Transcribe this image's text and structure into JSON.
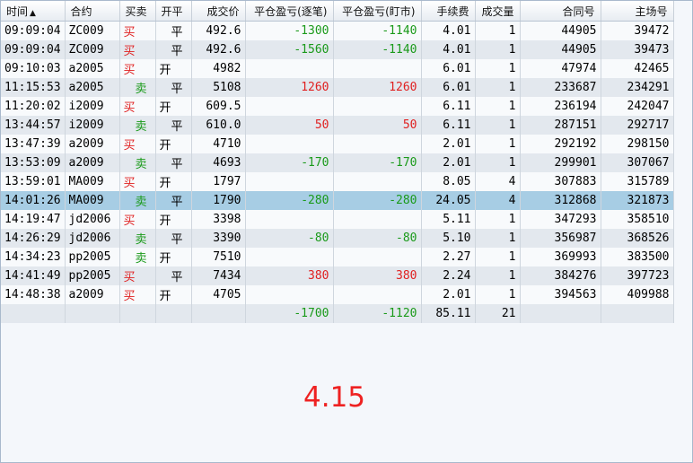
{
  "columns": [
    "时间",
    "合约",
    "买卖",
    "开平",
    "成交价",
    "平仓盈亏(逐笔)",
    "平仓盈亏(盯市)",
    "手续费",
    "成交量",
    "合同号",
    "主场号"
  ],
  "sort_indicator": "▲",
  "rows": [
    {
      "time": "09:09:04",
      "contract": "ZC009",
      "side": "买",
      "oc": "平",
      "price": "492.6",
      "pnl_trade": "-1300",
      "pnl_mtm": "-1140",
      "fee": "4.01",
      "qty": "1",
      "contract_no": "44905",
      "main_no": "39472"
    },
    {
      "time": "09:09:04",
      "contract": "ZC009",
      "side": "买",
      "oc": "平",
      "price": "492.6",
      "pnl_trade": "-1560",
      "pnl_mtm": "-1140",
      "fee": "4.01",
      "qty": "1",
      "contract_no": "44905",
      "main_no": "39473"
    },
    {
      "time": "09:10:03",
      "contract": "a2005",
      "side": "买",
      "oc": "开",
      "price": "4982",
      "pnl_trade": "",
      "pnl_mtm": "",
      "fee": "6.01",
      "qty": "1",
      "contract_no": "47974",
      "main_no": "42465"
    },
    {
      "time": "11:15:53",
      "contract": "a2005",
      "side": "卖",
      "oc": "平",
      "price": "5108",
      "pnl_trade": "1260",
      "pnl_mtm": "1260",
      "fee": "6.01",
      "qty": "1",
      "contract_no": "233687",
      "main_no": "234291"
    },
    {
      "time": "11:20:02",
      "contract": "i2009",
      "side": "买",
      "oc": "开",
      "price": "609.5",
      "pnl_trade": "",
      "pnl_mtm": "",
      "fee": "6.11",
      "qty": "1",
      "contract_no": "236194",
      "main_no": "242047"
    },
    {
      "time": "13:44:57",
      "contract": "i2009",
      "side": "卖",
      "oc": "平",
      "price": "610.0",
      "pnl_trade": "50",
      "pnl_mtm": "50",
      "fee": "6.11",
      "qty": "1",
      "contract_no": "287151",
      "main_no": "292717"
    },
    {
      "time": "13:47:39",
      "contract": "a2009",
      "side": "买",
      "oc": "开",
      "price": "4710",
      "pnl_trade": "",
      "pnl_mtm": "",
      "fee": "2.01",
      "qty": "1",
      "contract_no": "292192",
      "main_no": "298150"
    },
    {
      "time": "13:53:09",
      "contract": "a2009",
      "side": "卖",
      "oc": "平",
      "price": "4693",
      "pnl_trade": "-170",
      "pnl_mtm": "-170",
      "fee": "2.01",
      "qty": "1",
      "contract_no": "299901",
      "main_no": "307067"
    },
    {
      "time": "13:59:01",
      "contract": "MA009",
      "side": "买",
      "oc": "开",
      "price": "1797",
      "pnl_trade": "",
      "pnl_mtm": "",
      "fee": "8.05",
      "qty": "4",
      "contract_no": "307883",
      "main_no": "315789"
    },
    {
      "time": "14:01:26",
      "contract": "MA009",
      "side": "卖",
      "oc": "平",
      "price": "1790",
      "pnl_trade": "-280",
      "pnl_mtm": "-280",
      "fee": "24.05",
      "qty": "4",
      "contract_no": "312868",
      "main_no": "321873",
      "selected": true
    },
    {
      "time": "14:19:47",
      "contract": "jd2006",
      "side": "买",
      "oc": "开",
      "price": "3398",
      "pnl_trade": "",
      "pnl_mtm": "",
      "fee": "5.11",
      "qty": "1",
      "contract_no": "347293",
      "main_no": "358510"
    },
    {
      "time": "14:26:29",
      "contract": "jd2006",
      "side": "卖",
      "oc": "平",
      "price": "3390",
      "pnl_trade": "-80",
      "pnl_mtm": "-80",
      "fee": "5.10",
      "qty": "1",
      "contract_no": "356987",
      "main_no": "368526"
    },
    {
      "time": "14:34:23",
      "contract": "pp2005",
      "side": "卖",
      "oc": "开",
      "price": "7510",
      "pnl_trade": "",
      "pnl_mtm": "",
      "fee": "2.27",
      "qty": "1",
      "contract_no": "369993",
      "main_no": "383500"
    },
    {
      "time": "14:41:49",
      "contract": "pp2005",
      "side": "买",
      "oc": "平",
      "price": "7434",
      "pnl_trade": "380",
      "pnl_mtm": "380",
      "fee": "2.24",
      "qty": "1",
      "contract_no": "384276",
      "main_no": "397723"
    },
    {
      "time": "14:48:38",
      "contract": "a2009",
      "side": "买",
      "oc": "开",
      "price": "4705",
      "pnl_trade": "",
      "pnl_mtm": "",
      "fee": "2.01",
      "qty": "1",
      "contract_no": "394563",
      "main_no": "409988"
    }
  ],
  "totals": {
    "pnl_trade": "-1700",
    "pnl_mtm": "-1120",
    "fee": "85.11",
    "qty": "21"
  },
  "annotation": "4.15",
  "colors": {
    "buy": "#e02020",
    "sell": "#1a9a1a",
    "selected_row": "#a7cde4",
    "annotation": "#ee2222"
  }
}
